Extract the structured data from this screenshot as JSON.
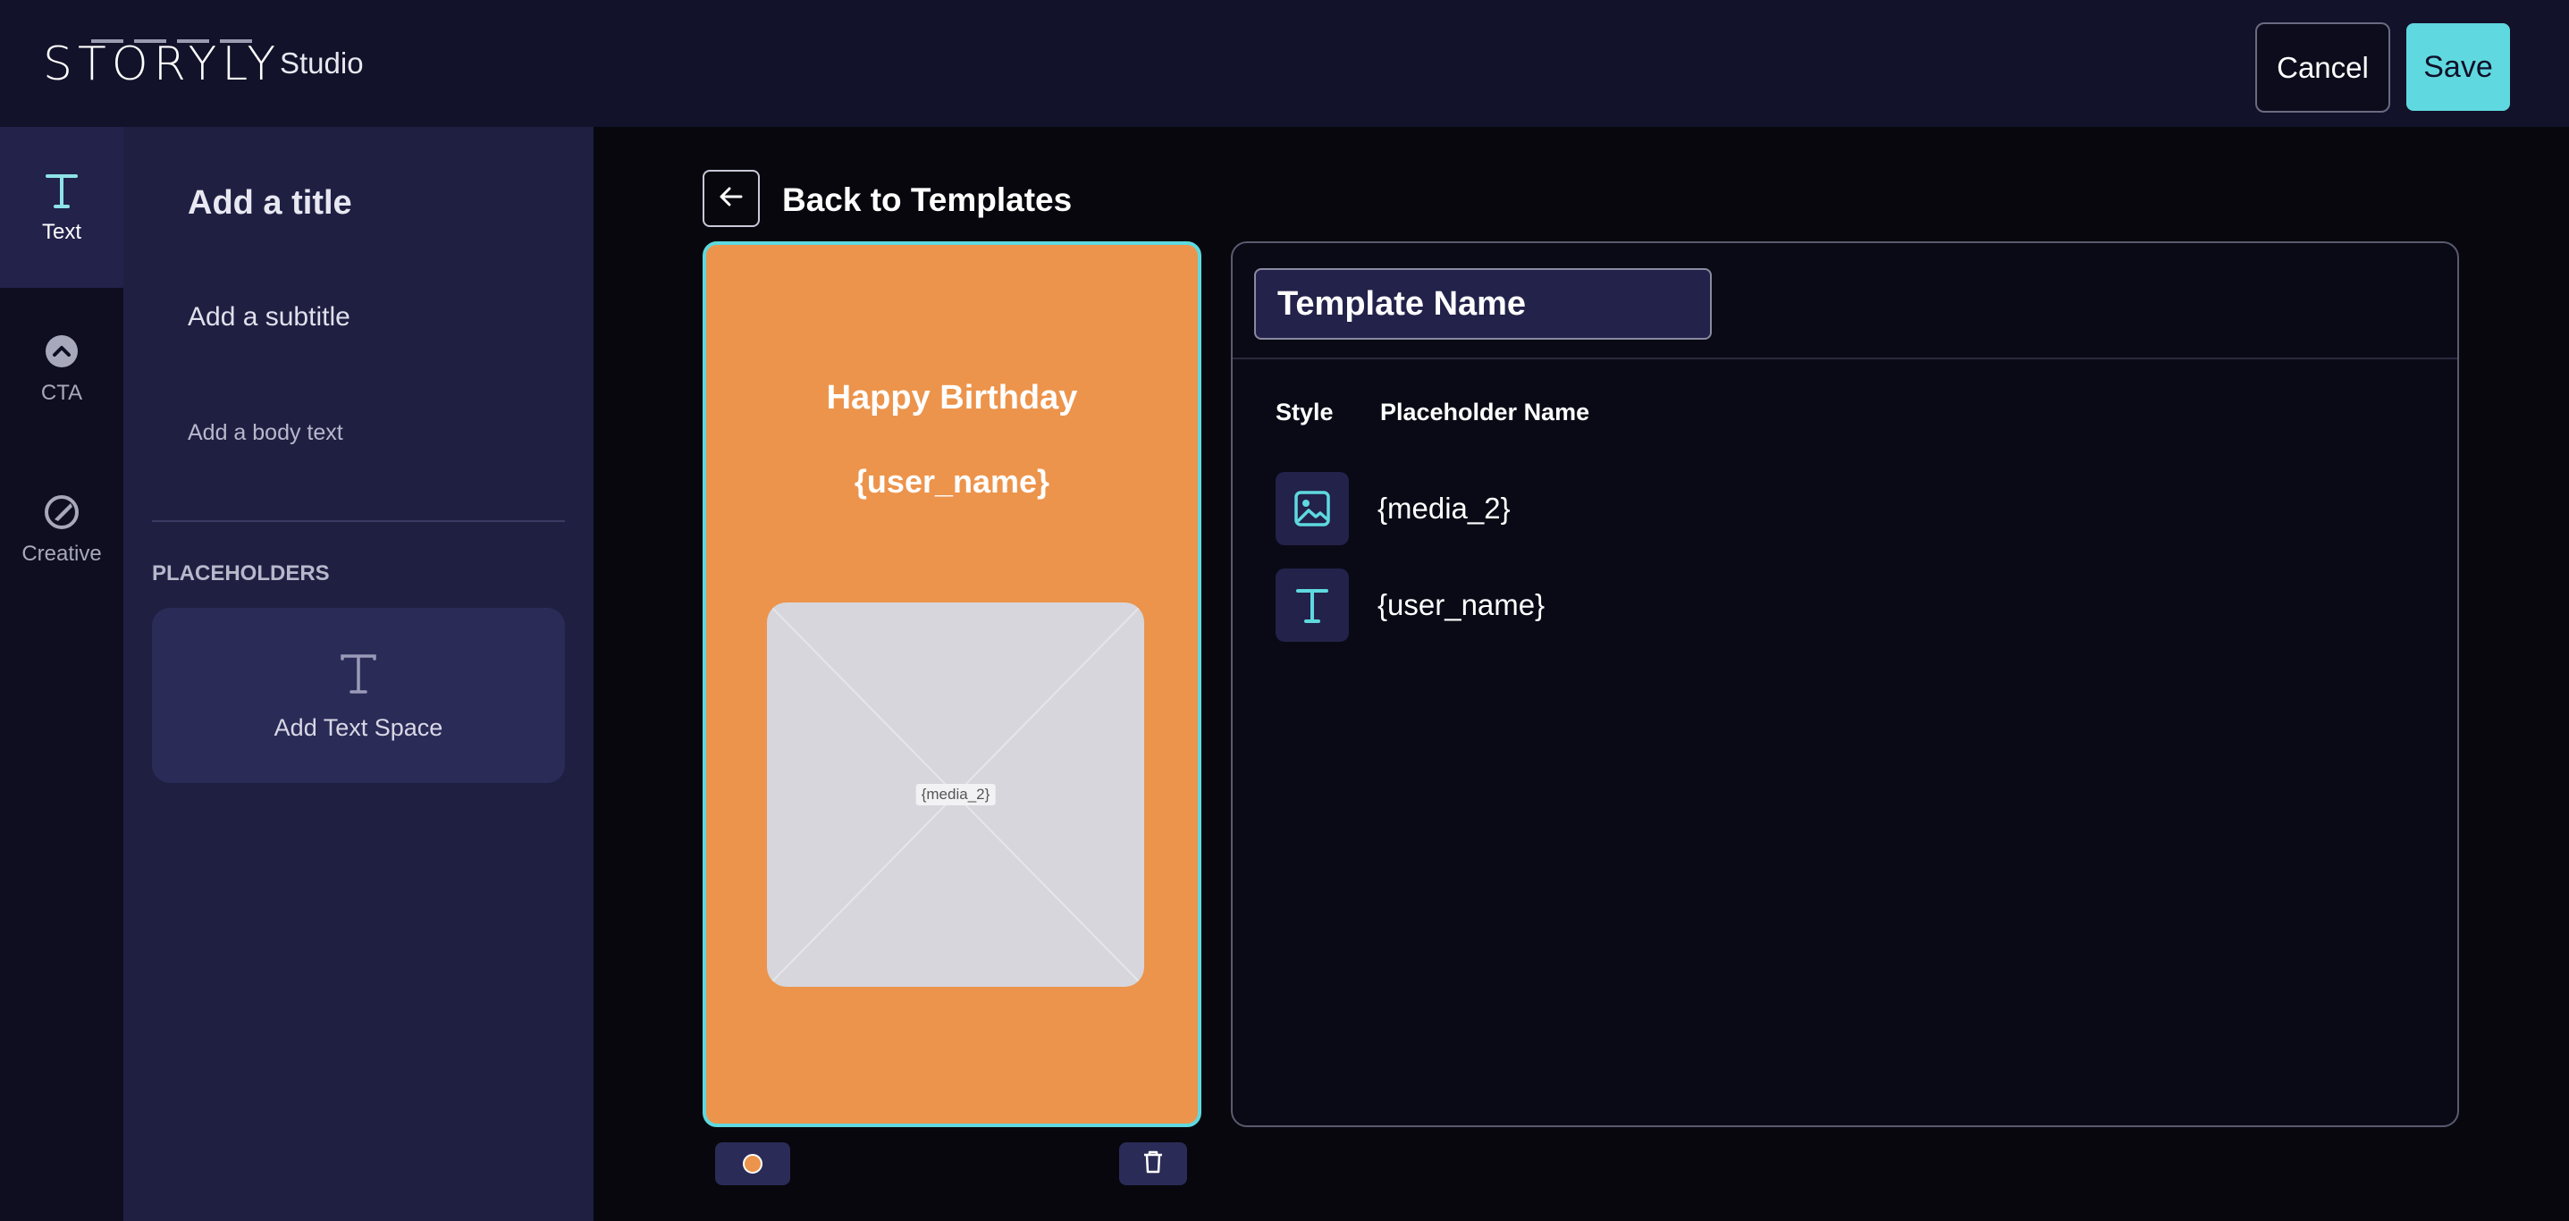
{
  "header": {
    "logo": "STORYLY",
    "product": "Studio",
    "cancel_label": "Cancel",
    "save_label": "Save"
  },
  "rail": {
    "items": [
      {
        "label": "Text",
        "icon": "text-icon",
        "active": true
      },
      {
        "label": "CTA",
        "icon": "cta-chevron-icon",
        "active": false
      },
      {
        "label": "Creative",
        "icon": "creative-icon",
        "active": false
      }
    ]
  },
  "panel": {
    "title": "Add a title",
    "subtitle": "Add a subtitle",
    "body": "Add a body text",
    "section_label": "PLACEHOLDERS",
    "add_text_space": "Add Text Space"
  },
  "back": {
    "label": "Back to Templates"
  },
  "story": {
    "title": "Happy Birthday",
    "user_placeholder": "{user_name}",
    "media_tag": "{media_2}",
    "background_color": "#ec944c"
  },
  "details": {
    "template_name": "Template Name",
    "col_style": "Style",
    "col_name": "Placeholder Name",
    "rows": [
      {
        "icon": "image-icon",
        "name": "{media_2}"
      },
      {
        "icon": "text-icon",
        "name": "{user_name}"
      }
    ]
  },
  "colors": {
    "accent": "#5fd9df",
    "panel": "#1f1f42"
  }
}
